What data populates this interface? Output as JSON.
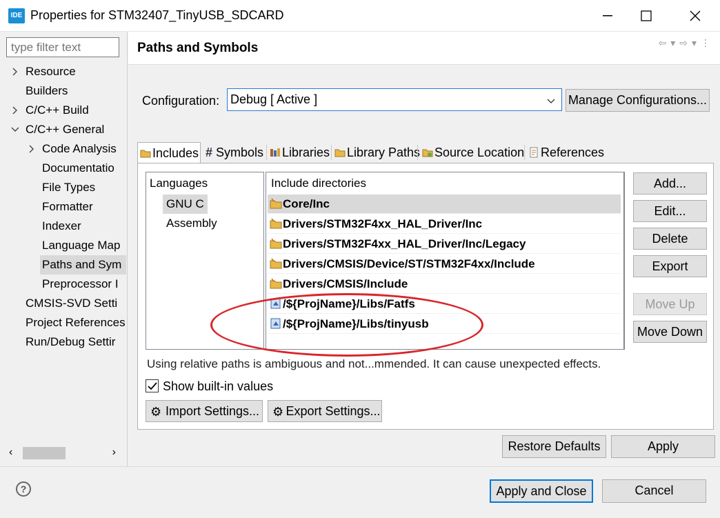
{
  "window": {
    "icon_text": "IDE",
    "title": "Properties for STM32407_TinyUSB_SDCARD"
  },
  "filter": {
    "placeholder": "type filter text"
  },
  "tree": [
    {
      "label": "Resource",
      "twisty": "›"
    },
    {
      "label": "Builders",
      "twisty": ""
    },
    {
      "label": "C/C++ Build",
      "twisty": "›"
    },
    {
      "label": "C/C++ General",
      "twisty": "⌄"
    },
    {
      "label": "Code Analysis",
      "twisty": "›"
    },
    {
      "label": "Documentatio",
      "twisty": ""
    },
    {
      "label": "File Types",
      "twisty": ""
    },
    {
      "label": "Formatter",
      "twisty": ""
    },
    {
      "label": "Indexer",
      "twisty": ""
    },
    {
      "label": "Language Map",
      "twisty": ""
    },
    {
      "label": "Paths and Sym",
      "twisty": ""
    },
    {
      "label": "Preprocessor I",
      "twisty": ""
    },
    {
      "label": "CMSIS-SVD Setti",
      "twisty": ""
    },
    {
      "label": "Project References",
      "twisty": ""
    },
    {
      "label": "Run/Debug Settir",
      "twisty": ""
    }
  ],
  "page": {
    "title": "Paths and Symbols"
  },
  "config": {
    "label": "Configuration:",
    "value": "Debug  [ Active ]",
    "manage_button": "Manage Configurations..."
  },
  "tabs": [
    {
      "label": "Includes",
      "icon": "folder-include-icon"
    },
    {
      "label": "Symbols",
      "icon": "hash-icon"
    },
    {
      "label": "Libraries",
      "icon": "library-icon"
    },
    {
      "label": "Library Paths",
      "icon": "library-path-icon"
    },
    {
      "label": "Source Location",
      "icon": "source-folder-icon"
    },
    {
      "label": "References",
      "icon": "reference-icon"
    }
  ],
  "languages": {
    "header": "Languages",
    "items": [
      "GNU C",
      "Assembly"
    ]
  },
  "includes": {
    "header": "Include directories",
    "items": [
      "Core/Inc",
      "Drivers/STM32F4xx_HAL_Driver/Inc",
      "Drivers/STM32F4xx_HAL_Driver/Inc/Legacy",
      "Drivers/CMSIS/Device/ST/STM32F4xx/Include",
      "Drivers/CMSIS/Include",
      "/${ProjName}/Libs/Fatfs",
      "/${ProjName}/Libs/tinyusb"
    ]
  },
  "side_buttons": {
    "add": "Add...",
    "edit": "Edit...",
    "delete": "Delete",
    "export": "Export",
    "move_up": "Move Up",
    "move_down": "Move Down"
  },
  "warning": "Using relative paths is ambiguous and not...mmended. It can cause unexpected effects.",
  "show_builtin": {
    "label": "Show built-in values",
    "checked": true
  },
  "settings_buttons": {
    "import": "Import Settings...",
    "export": "Export Settings..."
  },
  "bottom": {
    "restore": "Restore Defaults",
    "apply": "Apply",
    "apply_close": "Apply and Close",
    "cancel": "Cancel",
    "help": "?"
  },
  "colors": {
    "annotation": "#d9262b",
    "accent": "#0078d7"
  }
}
